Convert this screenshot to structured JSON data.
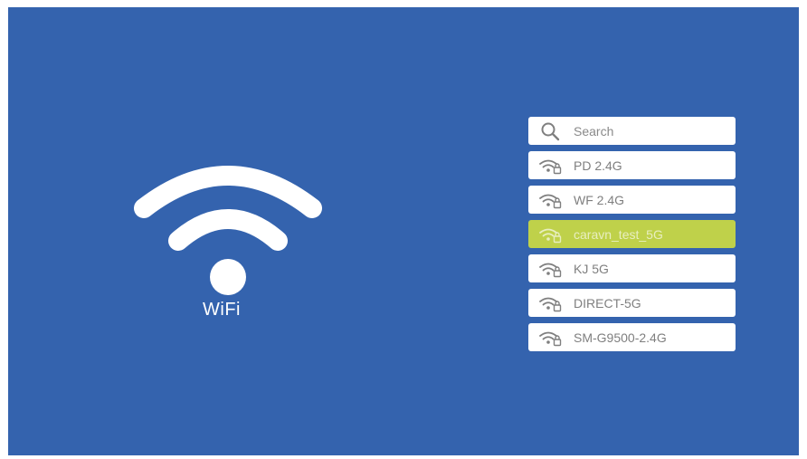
{
  "wifi": {
    "label": "WiFi",
    "icon": "wifi-icon"
  },
  "search": {
    "placeholder": "Search",
    "icon": "search-icon"
  },
  "networks": [
    {
      "ssid": "PD 2.4G",
      "icon": "wifi-locked-icon",
      "selected": false
    },
    {
      "ssid": "WF 2.4G",
      "icon": "wifi-locked-icon",
      "selected": false
    },
    {
      "ssid": "caravn_test_5G",
      "icon": "wifi-locked-icon",
      "selected": true
    },
    {
      "ssid": "KJ 5G",
      "icon": "wifi-locked-icon",
      "selected": false
    },
    {
      "ssid": "DIRECT-5G",
      "icon": "wifi-locked-icon",
      "selected": false
    },
    {
      "ssid": "SM-G9500-2.4G",
      "icon": "wifi-locked-icon",
      "selected": false
    }
  ],
  "colors": {
    "background": "#3463ae",
    "row": "#ffffff",
    "selected_row": "#bfd14a",
    "row_text": "#7f7f7f"
  }
}
